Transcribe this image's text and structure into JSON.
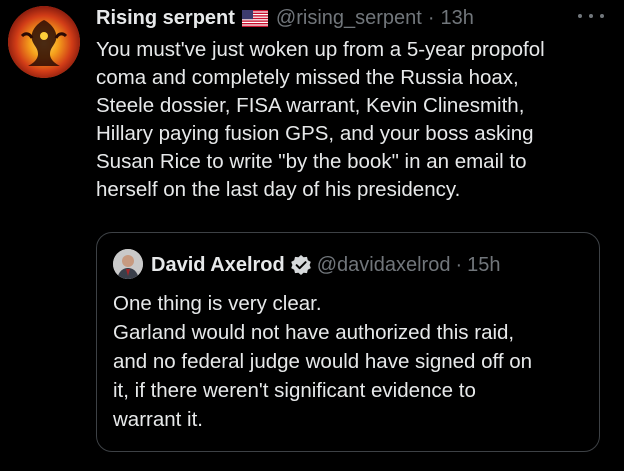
{
  "tweet": {
    "display_name": "Rising serpent",
    "handle": "@rising_serpent",
    "separator": "·",
    "time": "13h",
    "text": "You must've just woken up from a 5-year propofol\ncoma and completely missed the Russia hoax,\nSteele dossier, FISA warrant, Kevin Clinesmith,\nHillary paying fusion GPS, and your boss asking\nSusan Rice to write \"by the book\" in an email to\nherself on the last day of his presidency.",
    "flag_icon": "us-flag-icon",
    "more_icon": "more-options-icon"
  },
  "quoted_tweet": {
    "display_name": "David Axelrod",
    "handle": "@davidaxelrod",
    "separator": "·",
    "time": "15h",
    "text": "One thing is very clear.\nGarland would not have authorized this raid,\nand no federal judge would have signed off on\nit, if there weren't significant evidence to\nwarrant it.",
    "verified_icon": "verified-badge-icon"
  },
  "colors": {
    "background": "#000000",
    "primary_text": "#e7e9ea",
    "secondary_text": "#71767b",
    "border": "#3d4145"
  }
}
